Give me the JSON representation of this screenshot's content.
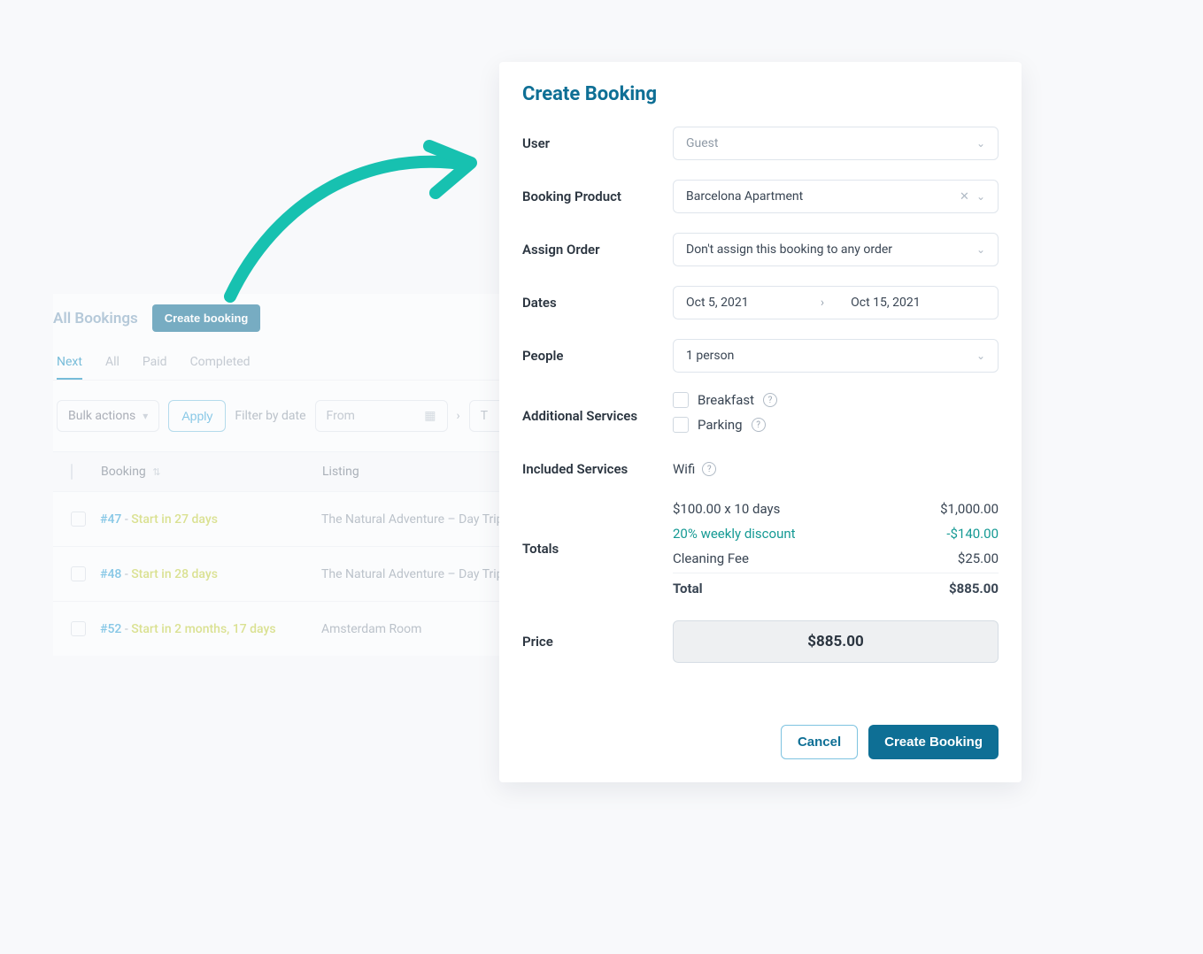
{
  "background": {
    "title": "All Bookings",
    "create_button": "Create booking",
    "tabs": [
      "Next",
      "All",
      "Paid",
      "Completed"
    ],
    "active_tab": 0,
    "bulk_actions_label": "Bulk actions",
    "apply_label": "Apply",
    "filter_label": "Filter by date",
    "from_placeholder": "From",
    "to_placeholder": "T",
    "columns": {
      "booking": "Booking",
      "listing": "Listing"
    },
    "rows": [
      {
        "id": "#47",
        "eta": "Start in 27 days",
        "listing": "The Natural Adventure – Day Trip"
      },
      {
        "id": "#48",
        "eta": "Start in 28 days",
        "listing": "The Natural Adventure – Day Trip"
      },
      {
        "id": "#52",
        "eta": "Start in 2 months, 17 days",
        "listing": "Amsterdam Room"
      }
    ]
  },
  "modal": {
    "title": "Create Booking",
    "labels": {
      "user": "User",
      "product": "Booking Product",
      "assign_order": "Assign Order",
      "dates": "Dates",
      "people": "People",
      "additional_services": "Additional Services",
      "included_services": "Included Services",
      "totals": "Totals",
      "price": "Price"
    },
    "user_value": "Guest",
    "product_value": "Barcelona Apartment",
    "assign_order_value": "Don't assign this booking to any order",
    "date_from": "Oct 5, 2021",
    "date_to": "Oct 15, 2021",
    "people_value": "1 person",
    "additional_services": [
      "Breakfast",
      "Parking"
    ],
    "included_services": [
      "Wifi"
    ],
    "totals": {
      "line_item": {
        "label": "$100.00 x 10 days",
        "value": "$1,000.00"
      },
      "discount": {
        "label": "20% weekly discount",
        "value": "-$140.00"
      },
      "fee": {
        "label": "Cleaning Fee",
        "value": "$25.00"
      },
      "total": {
        "label": "Total",
        "value": "$885.00"
      }
    },
    "price_value": "$885.00",
    "cancel_label": "Cancel",
    "submit_label": "Create Booking"
  }
}
